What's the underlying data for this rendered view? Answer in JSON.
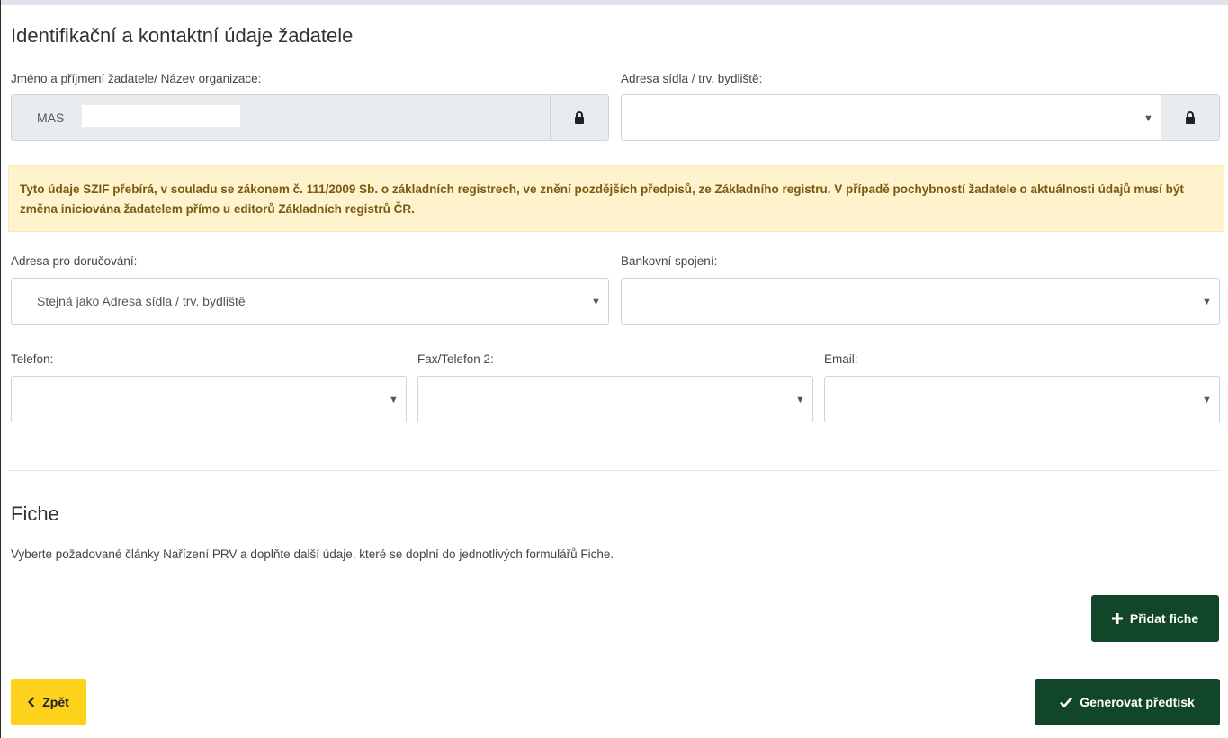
{
  "applicant": {
    "title": "Identifikační a kontaktní údaje žadatele",
    "name_label": "Jméno a příjmení žadatele/ Název organizace:",
    "name_value": "MAS",
    "address_label": "Adresa sídla / trv. bydliště:",
    "address_value": ""
  },
  "alert": {
    "text": "Tyto údaje SZIF přebírá, v souladu se zákonem č. 111/2009 Sb. o základních registrech, ve znění pozdějších předpisů, ze Základního registru. V případě pochybností žadatele o aktuálnosti údajů musí být změna iniciována žadatelem přímo u editorů Základních registrů ČR."
  },
  "contact": {
    "delivery_label": "Adresa pro doručování:",
    "delivery_value": "Stejná jako Adresa sídla / trv. bydliště",
    "bank_label": "Bankovní spojení:",
    "bank_value": "",
    "phone_label": "Telefon:",
    "phone_value": "",
    "fax_label": "Fax/Telefon 2:",
    "fax_value": "",
    "email_label": "Email:",
    "email_value": ""
  },
  "fiche": {
    "title": "Fiche",
    "description": "Vyberte požadované články Nařízení PRV a doplňte další údaje, které se doplní do jednotlivých formulářů Fiche.",
    "add_button": "Přidat fiche"
  },
  "footer": {
    "back_button": "Zpět",
    "generate_button": "Generovat předtisk"
  },
  "icons": {
    "lock": "lock-icon",
    "dropdown": "chevron-down-icon",
    "plus": "plus-icon",
    "check": "check-icon",
    "back": "chevron-left-icon"
  },
  "colors": {
    "primary_green": "#12462b",
    "back_yellow": "#fcd21d",
    "alert_bg": "#fef3cd",
    "alert_text": "#7a5a12",
    "readonly_bg": "#e9ecef"
  }
}
